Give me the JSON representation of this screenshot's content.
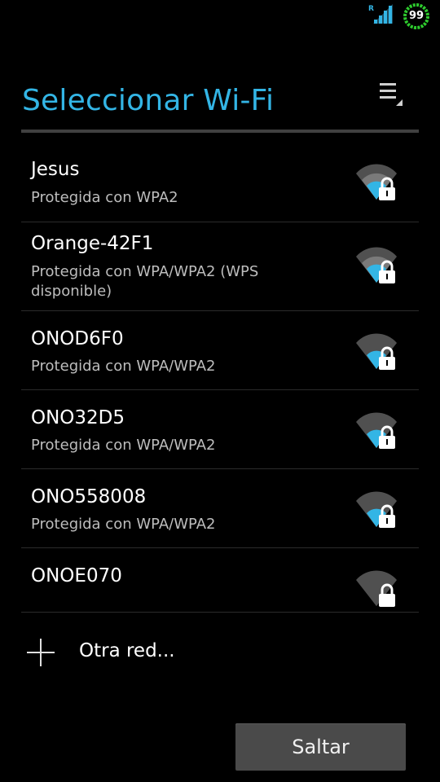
{
  "status_bar": {
    "roaming_indicator": "R",
    "battery_level": "99",
    "signal_icon": "signal-icon",
    "battery_icon": "battery-icon",
    "accent_color": "#33b5e5",
    "battery_color": "#2ecc2e"
  },
  "header": {
    "title": "Seleccionar Wi-Fi",
    "menu_icon": "overflow-menu-icon",
    "title_color": "#33b5e5"
  },
  "networks": [
    {
      "ssid": "Jesus",
      "security": "Protegida con WPA2",
      "icon": "wifi-locked-icon"
    },
    {
      "ssid": "Orange-42F1",
      "security": "Protegida con WPA/WPA2 (WPS disponible)",
      "icon": "wifi-locked-icon"
    },
    {
      "ssid": "ONOD6F0",
      "security": "Protegida con WPA/WPA2",
      "icon": "wifi-locked-icon"
    },
    {
      "ssid": "ONO32D5",
      "security": "Protegida con WPA/WPA2",
      "icon": "wifi-locked-icon"
    },
    {
      "ssid": "ONO558008",
      "security": "Protegida con WPA/WPA2",
      "icon": "wifi-locked-icon"
    },
    {
      "ssid": "ONOE070",
      "security": "",
      "icon": "wifi-locked-icon"
    }
  ],
  "other_network": {
    "label": "Otra red...",
    "icon": "plus-icon"
  },
  "footer": {
    "skip_label": "Saltar"
  }
}
